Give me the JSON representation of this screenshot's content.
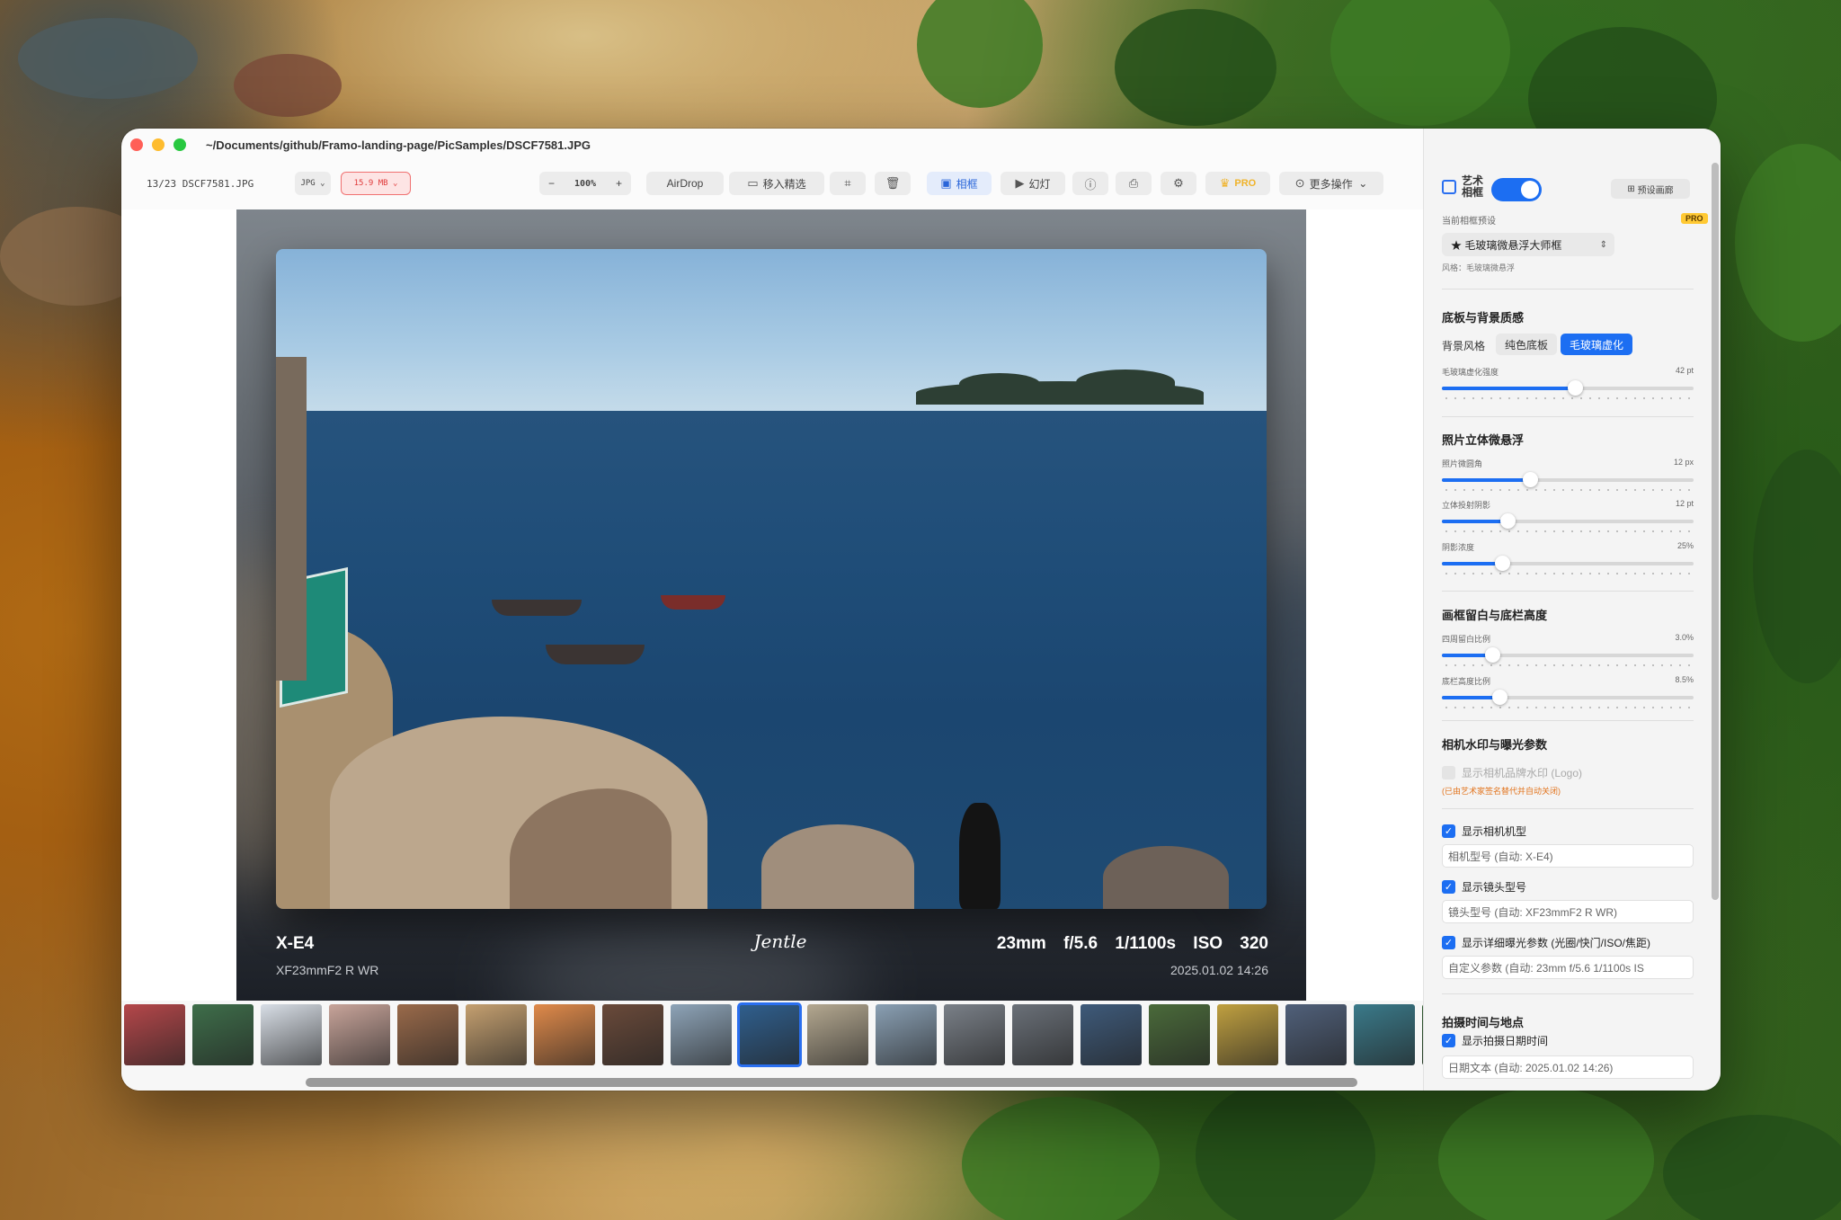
{
  "window": {
    "path": "~/Documents/github/Framo-landing-page/PicSamples/DSCF7581.JPG"
  },
  "toolbar": {
    "counter": "13/23",
    "filename": "DSCF7581.JPG",
    "format": "JPG",
    "size": "15.9 MB",
    "zoom": "100%",
    "airdrop": "AirDrop",
    "move_to_picks": "移入精选",
    "frame": "相框",
    "slideshow": "幻灯",
    "pro": "PRO",
    "more": "更多操作"
  },
  "photo_meta": {
    "camera": "X-E4",
    "lens": "XF23mmF2 R WR",
    "signature": "Jentle",
    "exposure": "23mm f/5.6 1/1100s ISO 320",
    "date": "2025.01.02 14:26"
  },
  "filmstrip": {
    "selected_index": 9,
    "thumb_colors": [
      "#b5474a",
      "#3e6e4a",
      "#d8dee6",
      "#c8a49a",
      "#9a6a4a",
      "#c5a070",
      "#e08a4a",
      "#6a4a3a",
      "#8ea4b8",
      "#2f5f8e",
      "#b4a890",
      "#8aa0b4",
      "#7a8088",
      "#6a7078",
      "#3e5a7a",
      "#4a6a3a",
      "#c0a040",
      "#50607a",
      "#3a7a8a",
      "#2e5a2e"
    ]
  },
  "sidebar": {
    "art_frame_label": "艺术相框",
    "preset_manage": "预设画廊",
    "current_preset_label": "当前相框预设",
    "pro_badge": "PRO",
    "preset_value": "★ 毛玻璃微悬浮大师框",
    "style_note": "风格：毛玻璃微悬浮",
    "sec_bg": "底板与背景质感",
    "bg_style_label": "背景风格",
    "seg_solid": "纯色底板",
    "seg_glass": "毛玻璃虚化",
    "sliders": [
      {
        "label": "毛玻璃虚化强度",
        "value": "42 pt",
        "level": 0.53
      },
      {
        "label": "照片微圆角",
        "value": "12 px",
        "level": 0.35
      },
      {
        "label": "立体投射阴影",
        "value": "12 pt",
        "level": 0.26
      },
      {
        "label": "阴影浓度",
        "value": "25%",
        "level": 0.24
      },
      {
        "label": "四周留白比例",
        "value": "3.0%",
        "level": 0.2
      },
      {
        "label": "底栏高度比例",
        "value": "8.5%",
        "level": 0.23
      }
    ],
    "sec_float": "照片立体微悬浮",
    "sec_margin": "画框留白与底栏高度",
    "sec_watermark": "相机水印与曝光参数",
    "show_logo": "显示相机品牌水印 (Logo)",
    "logo_warn": "(已由艺术家签名替代并自动关闭)",
    "show_model": "显示相机机型",
    "model_field": "相机型号 (自动: X-E4)",
    "show_lens": "显示镜头型号",
    "lens_field": "镜头型号 (自动: XF23mmF2 R WR)",
    "show_exposure": "显示详细曝光参数 (光圈/快门/ISO/焦距)",
    "exposure_field": "自定义参数 (自动: 23mm   f/5.6   1/1100s   IS",
    "sec_time": "拍摄时间与地点",
    "show_date": "显示拍摄日期时间",
    "date_field": "日期文本 (自动: 2025.01.02 14:26)"
  }
}
